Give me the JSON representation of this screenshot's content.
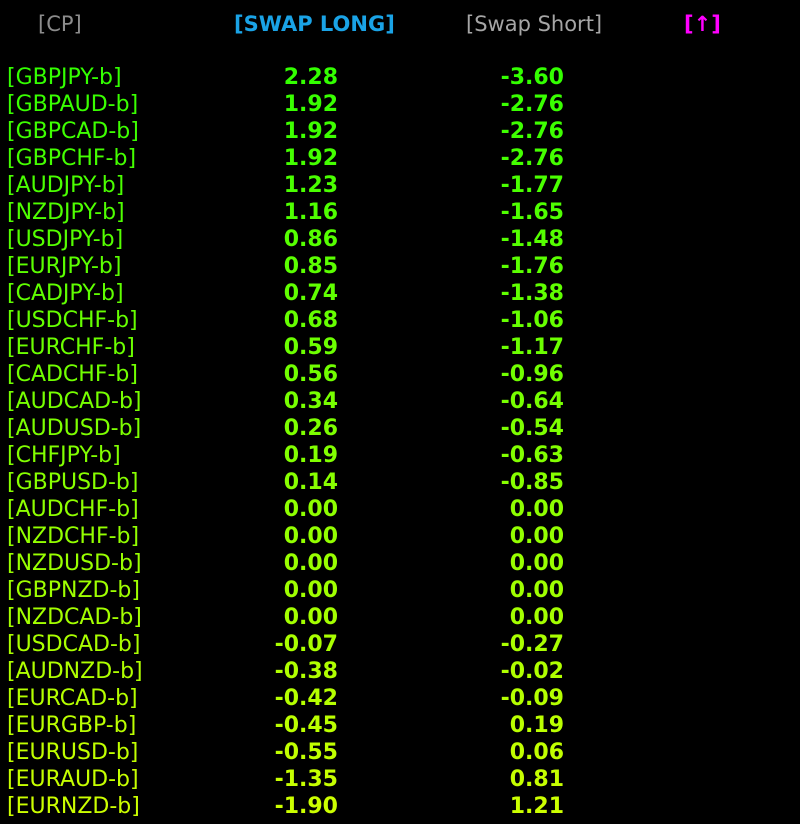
{
  "header": {
    "cp_label": "[CP]",
    "swap_long_label": "[SWAP LONG]",
    "swap_short_label": "[Swap Short]",
    "sort_label": "[↑]"
  },
  "colors": {
    "background": "#000000",
    "header_cp": "#8c8c8c",
    "header_long": "#1aa3e6",
    "header_short": "#a6a6a6",
    "header_sort": "#ff00ff",
    "row_start": "#33ff00",
    "row_end": "#ccff00"
  },
  "rows": [
    {
      "symbol": "[GBPJPY-b]",
      "long": "2.28",
      "short": "-3.60"
    },
    {
      "symbol": "[GBPAUD-b]",
      "long": "1.92",
      "short": "-2.76"
    },
    {
      "symbol": "[GBPCAD-b]",
      "long": "1.92",
      "short": "-2.76"
    },
    {
      "symbol": "[GBPCHF-b]",
      "long": "1.92",
      "short": "-2.76"
    },
    {
      "symbol": "[AUDJPY-b]",
      "long": "1.23",
      "short": "-1.77"
    },
    {
      "symbol": "[NZDJPY-b]",
      "long": "1.16",
      "short": "-1.65"
    },
    {
      "symbol": "[USDJPY-b]",
      "long": "0.86",
      "short": "-1.48"
    },
    {
      "symbol": "[EURJPY-b]",
      "long": "0.85",
      "short": "-1.76"
    },
    {
      "symbol": "[CADJPY-b]",
      "long": "0.74",
      "short": "-1.38"
    },
    {
      "symbol": "[USDCHF-b]",
      "long": "0.68",
      "short": "-1.06"
    },
    {
      "symbol": "[EURCHF-b]",
      "long": "0.59",
      "short": "-1.17"
    },
    {
      "symbol": "[CADCHF-b]",
      "long": "0.56",
      "short": "-0.96"
    },
    {
      "symbol": "[AUDCAD-b]",
      "long": "0.34",
      "short": "-0.64"
    },
    {
      "symbol": "[AUDUSD-b]",
      "long": "0.26",
      "short": "-0.54"
    },
    {
      "symbol": "[CHFJPY-b]",
      "long": "0.19",
      "short": "-0.63"
    },
    {
      "symbol": "[GBPUSD-b]",
      "long": "0.14",
      "short": "-0.85"
    },
    {
      "symbol": "[AUDCHF-b]",
      "long": "0.00",
      "short": "0.00"
    },
    {
      "symbol": "[NZDCHF-b]",
      "long": "0.00",
      "short": "0.00"
    },
    {
      "symbol": "[NZDUSD-b]",
      "long": "0.00",
      "short": "0.00"
    },
    {
      "symbol": "[GBPNZD-b]",
      "long": "0.00",
      "short": "0.00"
    },
    {
      "symbol": "[NZDCAD-b]",
      "long": "0.00",
      "short": "0.00"
    },
    {
      "symbol": "[USDCAD-b]",
      "long": "-0.07",
      "short": "-0.27"
    },
    {
      "symbol": "[AUDNZD-b]",
      "long": "-0.38",
      "short": "-0.02"
    },
    {
      "symbol": "[EURCAD-b]",
      "long": "-0.42",
      "short": "-0.09"
    },
    {
      "symbol": "[EURGBP-b]",
      "long": "-0.45",
      "short": "0.19"
    },
    {
      "symbol": "[EURUSD-b]",
      "long": "-0.55",
      "short": "0.06"
    },
    {
      "symbol": "[EURAUD-b]",
      "long": "-1.35",
      "short": "0.81"
    },
    {
      "symbol": "[EURNZD-b]",
      "long": "-1.90",
      "short": "1.21"
    }
  ]
}
